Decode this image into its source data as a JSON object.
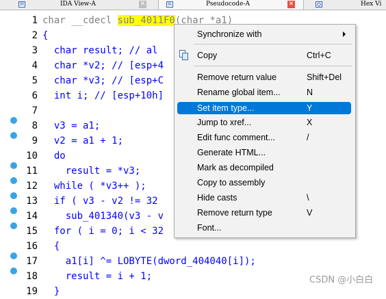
{
  "tabs": {
    "ida": "IDA View-A",
    "pseudo": "Pseudocode-A",
    "hex": "Hex Vi",
    "close_glyph": "✕"
  },
  "code": {
    "line_numbers": [
      "1",
      "2",
      "3",
      "4",
      "5",
      "6",
      "7",
      "8",
      "9",
      "10",
      "11",
      "12",
      "13",
      "14",
      "15",
      "16",
      "17",
      "18",
      "19"
    ],
    "l1_a": "char __cdecl ",
    "l1_name": "sub_4011F0",
    "l1_b": "(char *a1)",
    "l2": "{",
    "l3_a": "  char result; ",
    "l3_c": "// al",
    "l4_a": "  char *v2; ",
    "l4_c": "// [esp+4",
    "l5_a": "  char *v3; ",
    "l5_c": "// [esp+C",
    "l6_a": "  int i; ",
    "l6_c": "// [esp+10h]",
    "l8": "  v3 = a1;",
    "l9": "  v2 = a1 + 1;",
    "l10": "  do",
    "l11": "    result = *v3;",
    "l12": "  while ( *v3++ );",
    "l13": "  if ( v3 - v2 != 32",
    "l14": "    sub_401340(v3 - v",
    "l15": "  for ( i = 0; i < 32",
    "l16": "  {",
    "l17": "    a1[i] ^= LOBYTE(dword_404040[i]);",
    "l18": "    result = i + 1;",
    "l19": "  }"
  },
  "menu": {
    "items": [
      {
        "label": "Synchronize with",
        "key": ""
      },
      {
        "label": "Copy",
        "key": "Ctrl+C"
      },
      {
        "label": "Remove return value",
        "key": "Shift+Del"
      },
      {
        "label": "Rename global item...",
        "key": "N"
      },
      {
        "label": "Set item type...",
        "key": "Y"
      },
      {
        "label": "Jump to xref...",
        "key": "X"
      },
      {
        "label": "Edit func comment...",
        "key": "/"
      },
      {
        "label": "Generate HTML...",
        "key": ""
      },
      {
        "label": "Mark as decompiled",
        "key": ""
      },
      {
        "label": "Copy to assembly",
        "key": ""
      },
      {
        "label": "Hide casts",
        "key": "\\"
      },
      {
        "label": "Remove return type",
        "key": "V"
      },
      {
        "label": "Font...",
        "key": ""
      }
    ]
  },
  "watermark": "CSDN @小白白",
  "colors": {
    "accent": "#0078d7",
    "code_blue": "#0000ff",
    "highlight": "#ffff00",
    "breakpoint": "#3aa3e3"
  },
  "icons": [
    "ida-view-icon",
    "pseudocode-icon",
    "hex-view-icon",
    "copy-icon",
    "submenu-arrow-icon"
  ]
}
